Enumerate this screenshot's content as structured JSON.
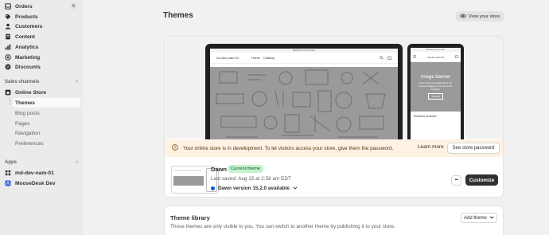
{
  "sidebar": {
    "items": [
      {
        "label": "Orders",
        "icon": "inbox-icon",
        "badge": "6"
      },
      {
        "label": "Products",
        "icon": "tag-icon"
      },
      {
        "label": "Customers",
        "icon": "person-icon"
      },
      {
        "label": "Content",
        "icon": "document-icon"
      },
      {
        "label": "Analytics",
        "icon": "bar-chart-icon"
      },
      {
        "label": "Marketing",
        "icon": "target-icon"
      },
      {
        "label": "Discounts",
        "icon": "discount-icon"
      }
    ],
    "sales_channels_heading": "Sales channels",
    "online_store": {
      "label": "Online Store",
      "icon": "store-icon"
    },
    "sub_items": [
      {
        "label": "Themes",
        "active": true
      },
      {
        "label": "Blog posts"
      },
      {
        "label": "Pages"
      },
      {
        "label": "Navigation"
      },
      {
        "label": "Preferences"
      }
    ],
    "apps_heading": "Apps",
    "apps": [
      {
        "label": "md-dev-nam-01",
        "icon": "app-grid-icon"
      },
      {
        "label": "MooseDesk Dev",
        "icon": "moosedesk-icon"
      }
    ]
  },
  "main": {
    "title": "Themes",
    "view_store_label": "View your store",
    "preview": {
      "announcement": "Welcome to our store",
      "store_name": "md-dev-nam-01",
      "nav_home": "Home",
      "nav_catalog": "Catalog",
      "phone_store_name": "md-dev-nam-01",
      "banner_title": "Image banner",
      "banner_sub": "Give customers details about the banner image(s) or content on the template.",
      "banner_button": "Shop all",
      "featured": "Featured products"
    },
    "notice": {
      "text": "Your online store is in development. To let visitors access your store, give them the password.",
      "learn_more": "Learn more",
      "button": "See store password"
    },
    "current_theme": {
      "name": "Dawn",
      "badge": "Current theme",
      "saved": "Last saved: Aug 15 at 2:58 am EDT",
      "version": "Dawn version 15.2.0 available",
      "more_label": "•••",
      "customize_label": "Customize",
      "version_dot_color": "#005bd3"
    },
    "library": {
      "title": "Theme library",
      "description": "These themes are only visible to you. You can switch to another theme by publishing it to your store.",
      "add_theme_label": "Add theme"
    }
  }
}
